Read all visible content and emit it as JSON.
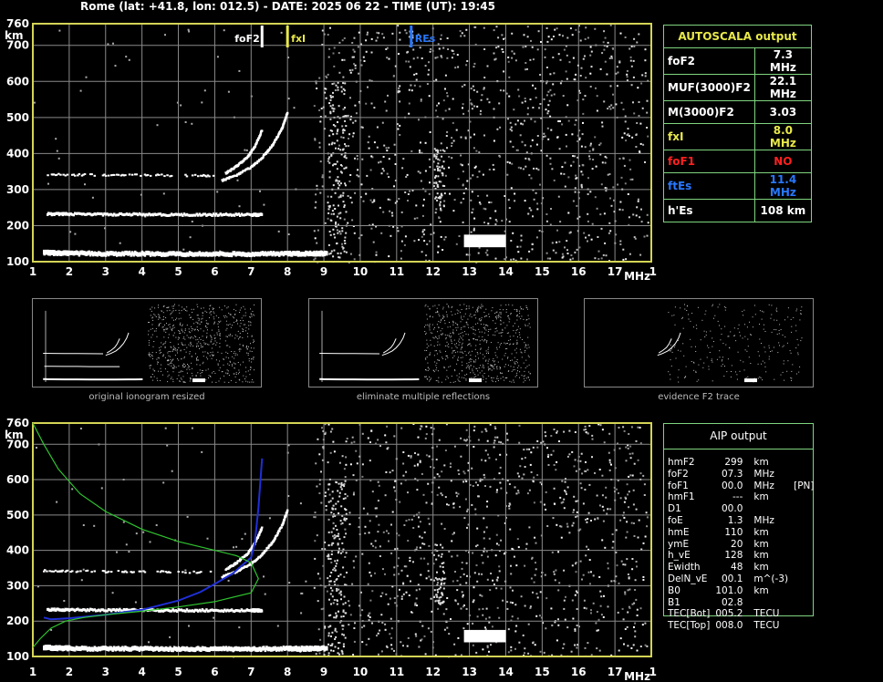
{
  "header": {
    "title": "Rome (lat: +41.8, lon: 012.5) - DATE: 2025 06 22 - TIME (UT): 19:45"
  },
  "colors": {
    "grid": "#8a8a8a",
    "frame": "#d4d456",
    "panel_border": "#7fd47f",
    "foF2": "#ffffff",
    "fxI": "#e8e84a",
    "foF1": "#ff2020",
    "ftEs": "#2878ff",
    "profile": "#1f2fd6",
    "model": "#2fc42f"
  },
  "axes": {
    "km_label": "km",
    "mhz_label": "MHz",
    "y_ticks": [
      "760",
      "700",
      "600",
      "500",
      "400",
      "300",
      "200",
      "100"
    ],
    "x_ticks": [
      "1",
      "2",
      "3",
      "4",
      "5",
      "6",
      "7",
      "8",
      "9",
      "10",
      "11",
      "12",
      "13",
      "14",
      "15",
      "16",
      "17",
      "18"
    ]
  },
  "chart_data": [
    {
      "type": "scatter",
      "name_ref": "top-ionogram",
      "xlim": [
        1,
        18
      ],
      "ylim": [
        100,
        760
      ],
      "grid": true,
      "markers": [
        {
          "label": "foF2",
          "x": 7.3,
          "color": "#ffffff"
        },
        {
          "label": "fxI",
          "x": 8.0,
          "color": "#e8e84a"
        },
        {
          "label": "REs",
          "x": 11.4,
          "color": "#2878ff"
        }
      ],
      "traces": [
        {
          "label": "E-layer echo",
          "x": [
            1.3,
            1.6,
            2.0,
            3.0,
            4.0,
            5.0,
            6.0,
            7.0,
            8.0,
            8.5,
            9.1
          ],
          "y": [
            125,
            124,
            123,
            122,
            122,
            121,
            121,
            121,
            122,
            122,
            123
          ]
        },
        {
          "label": "multiple reflection",
          "x": [
            1.4,
            2.0,
            3.0,
            4.0,
            5.0,
            6.0,
            7.0,
            7.3
          ],
          "y": [
            232,
            232,
            231,
            231,
            230,
            230,
            230,
            230
          ]
        },
        {
          "label": "F2 ordinary trace",
          "x": [
            6.2,
            6.6,
            7.0,
            7.3,
            7.6,
            7.85,
            8.0
          ],
          "y": [
            325,
            340,
            362,
            388,
            425,
            470,
            515
          ]
        },
        {
          "label": "F2 extraordinary trace",
          "x": [
            6.3,
            6.6,
            6.9,
            7.1,
            7.3
          ],
          "y": [
            345,
            365,
            390,
            420,
            465
          ]
        },
        {
          "label": "faint trace",
          "x": [
            1.3,
            2.0,
            3.0,
            4.0,
            5.0,
            6.0
          ],
          "y": [
            342,
            341,
            340,
            340,
            339,
            338
          ]
        }
      ]
    },
    {
      "type": "scatter",
      "name_ref": "bottom-ionogram",
      "xlim": [
        1,
        18
      ],
      "ylim": [
        100,
        760
      ],
      "grid": true,
      "traces": [
        {
          "label": "E-layer echo",
          "x": [
            1.3,
            1.6,
            2.0,
            3.0,
            4.0,
            5.0,
            6.0,
            7.0,
            8.0,
            8.5,
            9.1
          ],
          "y": [
            125,
            124,
            123,
            122,
            122,
            121,
            121,
            121,
            122,
            122,
            123
          ]
        },
        {
          "label": "multiple reflection",
          "x": [
            1.4,
            2.0,
            3.0,
            4.0,
            5.0,
            6.0,
            7.0,
            7.3
          ],
          "y": [
            232,
            232,
            231,
            231,
            230,
            230,
            230,
            230
          ]
        },
        {
          "label": "F2 ordinary trace",
          "x": [
            6.2,
            6.6,
            7.0,
            7.3,
            7.6,
            7.85,
            8.0
          ],
          "y": [
            325,
            340,
            362,
            388,
            425,
            470,
            515
          ]
        },
        {
          "label": "F2 extraordinary trace",
          "x": [
            6.3,
            6.6,
            6.9,
            7.1,
            7.3
          ],
          "y": [
            345,
            365,
            390,
            420,
            465
          ]
        },
        {
          "label": "faint trace",
          "x": [
            1.3,
            2.0,
            3.0,
            4.0,
            5.0,
            6.0
          ],
          "y": [
            342,
            341,
            340,
            340,
            339,
            338
          ]
        }
      ],
      "lines": [
        {
          "label": "AIP profile",
          "color": "#1f2fd6",
          "x": [
            1.3,
            1.5,
            2.0,
            3.0,
            4.0,
            5.0,
            5.6,
            6.0,
            6.5,
            7.0,
            7.1,
            7.2,
            7.3
          ],
          "y": [
            210,
            205,
            208,
            218,
            232,
            258,
            282,
            305,
            335,
            380,
            420,
            520,
            660
          ]
        },
        {
          "label": "model group height",
          "color": "#2fc42f",
          "x": [
            1.0,
            1.3,
            1.7,
            2.3,
            3.0,
            4.0,
            5.0,
            6.0,
            6.6,
            7.0,
            7.2,
            7.0,
            6.0,
            5.0,
            4.0,
            3.0,
            2.4,
            1.9,
            1.5,
            1.2,
            1.0
          ],
          "y": [
            760,
            700,
            630,
            560,
            510,
            460,
            425,
            400,
            385,
            365,
            320,
            280,
            255,
            240,
            228,
            218,
            210,
            200,
            180,
            150,
            125
          ]
        }
      ]
    }
  ],
  "autoscala": {
    "title": "AUTOSCALA output",
    "rows": [
      {
        "label": "foF2",
        "value": "7.3 MHz",
        "color": "#ffffff"
      },
      {
        "label": "MUF(3000)F2",
        "value": "22.1 MHz",
        "color": "#ffffff"
      },
      {
        "label": "M(3000)F2",
        "value": "3.03",
        "color": "#ffffff"
      },
      {
        "label": "fxI",
        "value": "8.0 MHz",
        "color": "#e8e84a"
      },
      {
        "label": "foF1",
        "value": "NO",
        "color": "#ff2020"
      },
      {
        "label": "ftEs",
        "value": "11.4 MHz",
        "color": "#2878ff"
      },
      {
        "label": "h'Es",
        "value": "108    km",
        "color": "#ffffff"
      }
    ]
  },
  "aip": {
    "title": "AIP output",
    "rows": [
      [
        "hmF2",
        "299",
        "km",
        ""
      ],
      [
        "foF2",
        "07.3",
        "MHz",
        ""
      ],
      [
        "foF1",
        "00.0",
        "MHz",
        "[PN]"
      ],
      [
        "hmF1",
        "---",
        "km",
        ""
      ],
      [
        "D1",
        "00.0",
        "",
        ""
      ],
      [
        "foE",
        "1.3",
        "MHz",
        ""
      ],
      [
        "hmE",
        "110",
        "km",
        ""
      ],
      [
        "ymE",
        "20",
        "km",
        ""
      ],
      [
        "h_vE",
        "128",
        "km",
        ""
      ],
      [
        "Ewidth",
        "48",
        "km",
        ""
      ],
      [
        "DelN_vE",
        "00.1",
        "m^(-3)",
        ""
      ],
      [
        "B0",
        "101.0",
        "km",
        ""
      ],
      [
        "B1",
        "02.8",
        "",
        ""
      ],
      [
        "TEC[Bot]",
        "005.2",
        "TECU",
        ""
      ],
      [
        "TEC[Top]",
        "008.0",
        "TECU",
        ""
      ]
    ]
  },
  "thumbnails": [
    {
      "caption": "original ionogram resized"
    },
    {
      "caption": "eliminate multiple reflections"
    },
    {
      "caption": "evidence F2 trace"
    }
  ]
}
